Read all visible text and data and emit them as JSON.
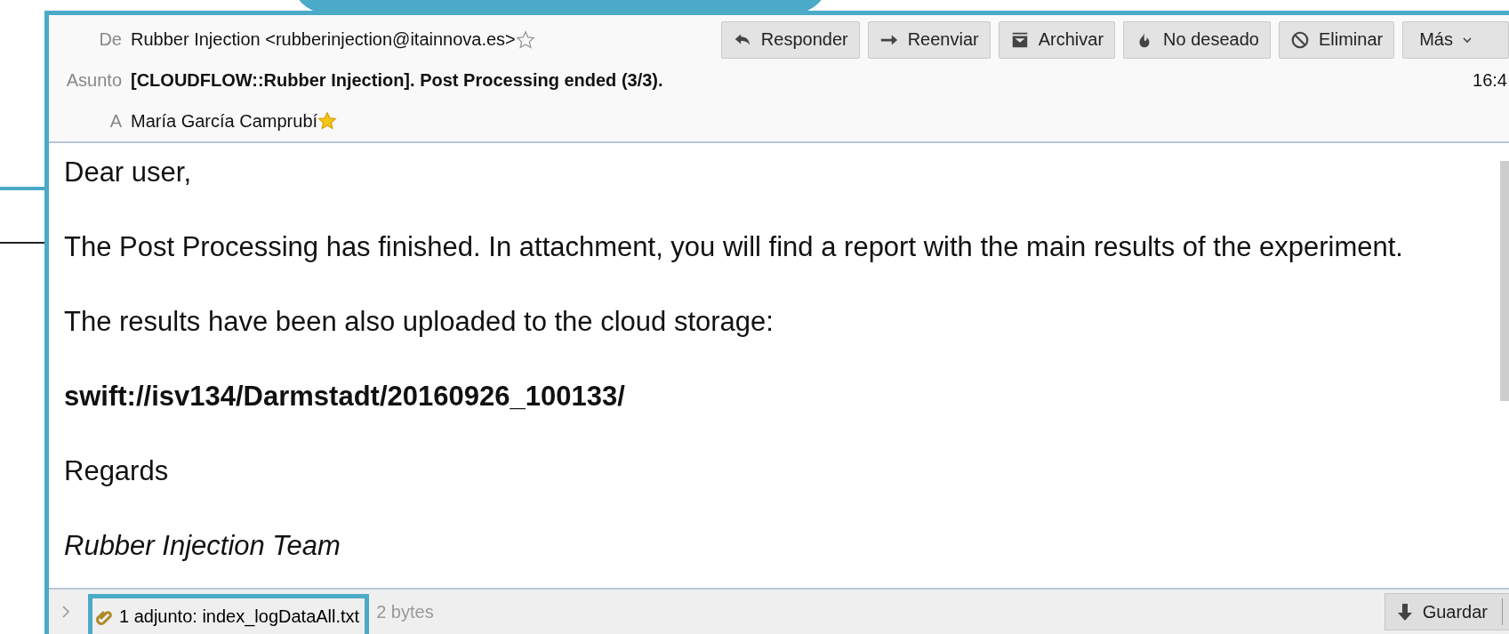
{
  "header": {
    "from_label": "De",
    "from": "Rubber Injection <rubberinjection@itainnova.es>",
    "from_starred": false,
    "subject_label": "Asunto",
    "subject": "[CLOUDFLOW::Rubber Injection]. Post Processing ended (3/3).",
    "time": "16:4",
    "to_label": "A",
    "to": "María García Camprubí",
    "to_starred": true
  },
  "toolbar": [
    {
      "label": "Responder",
      "kind": "reply"
    },
    {
      "label": "Reenviar",
      "kind": "forward"
    },
    {
      "label": "Archivar",
      "kind": "archive"
    },
    {
      "label": "No deseado",
      "kind": "junk"
    },
    {
      "label": "Eliminar",
      "kind": "delete"
    },
    {
      "label": "Más",
      "kind": "more"
    }
  ],
  "body": [
    {
      "text": "Dear user,",
      "kind": "plain"
    },
    {
      "text": "The Post Processing has finished. In attachment, you will find a report with the main results of the experiment.",
      "kind": "plain"
    },
    {
      "text": "The results have been also uploaded to the cloud storage:",
      "kind": "plain"
    },
    {
      "text": "swift://isv134/Darmstadt/20160926_100133/",
      "kind": "bold"
    },
    {
      "text": "Regards",
      "kind": "plain"
    },
    {
      "text": "Rubber Injection Team",
      "kind": "italic"
    }
  ],
  "attachments": {
    "summary": "1 adjunto: index_logDataAll.txt",
    "size": "2 bytes",
    "save_button": "Guardar"
  }
}
